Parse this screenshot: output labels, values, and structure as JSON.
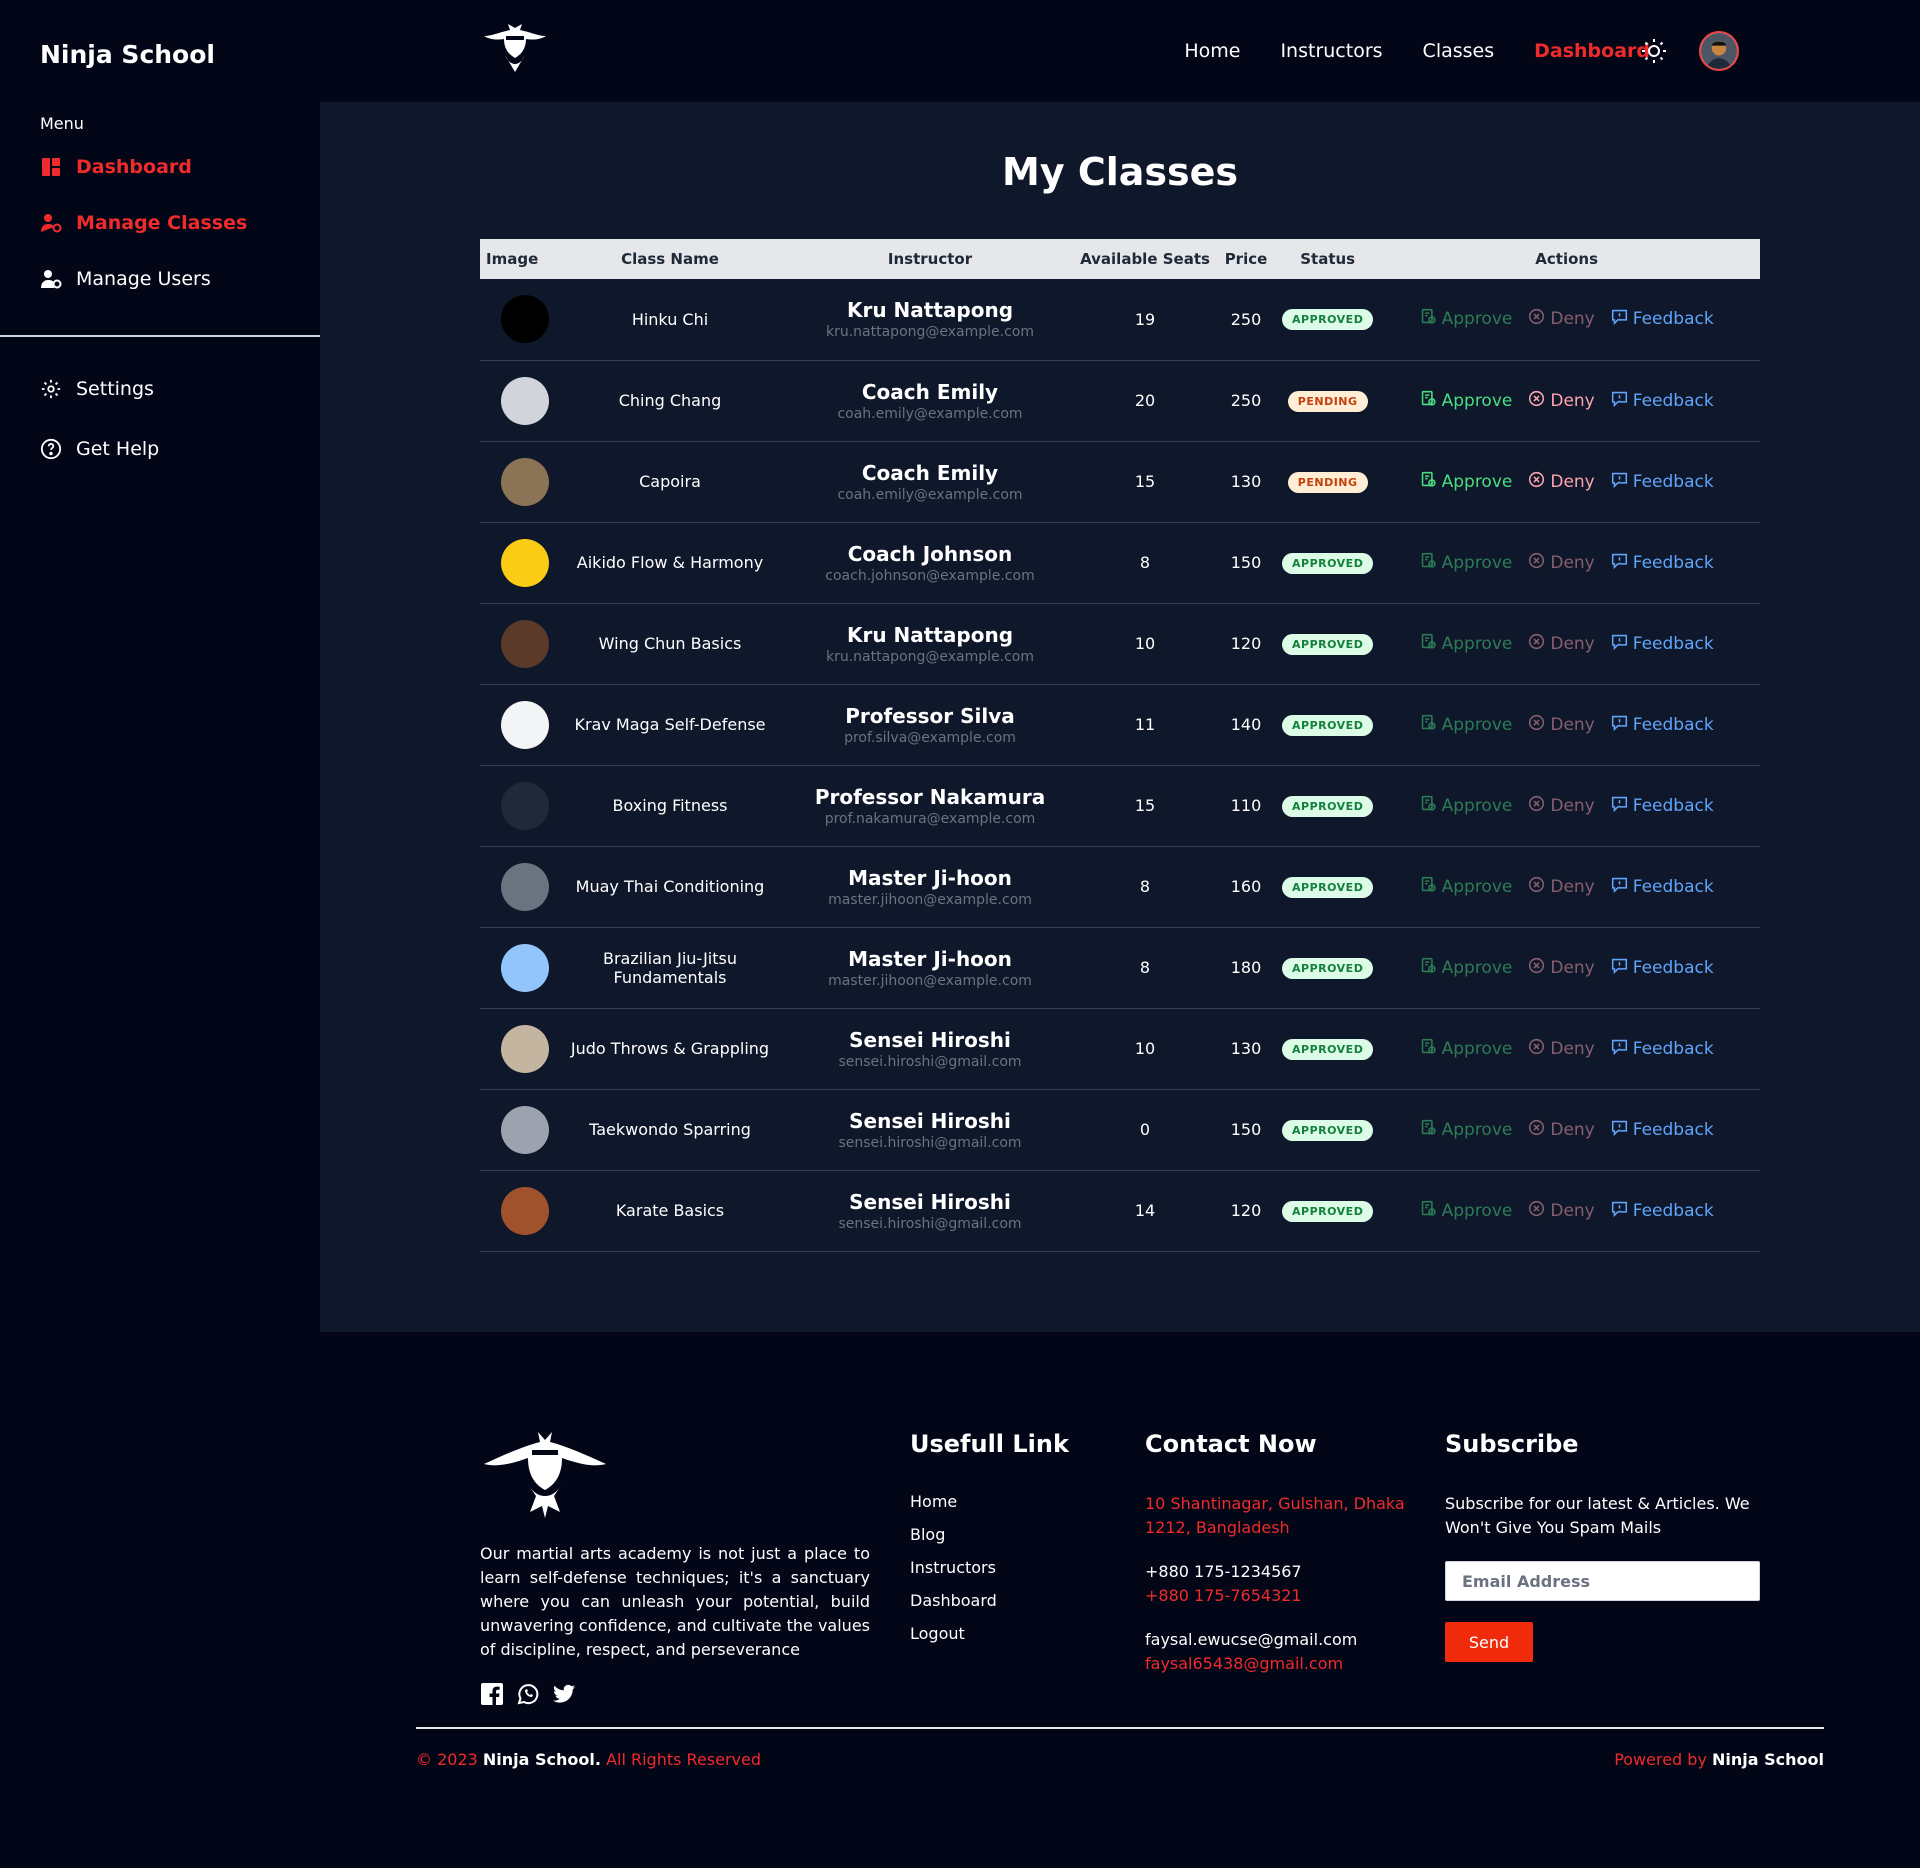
{
  "sidebar": {
    "brand": "Ninja School",
    "menu_label": "Menu",
    "items": [
      {
        "label": "Dashboard"
      },
      {
        "label": "Manage Classes"
      },
      {
        "label": "Manage Users"
      }
    ],
    "bottom_items": [
      {
        "label": "Settings"
      },
      {
        "label": "Get Help"
      }
    ]
  },
  "topnav": {
    "links": [
      "Home",
      "Instructors",
      "Classes",
      "Dashboard"
    ],
    "active": "Dashboard"
  },
  "main": {
    "title": "My Classes",
    "columns": [
      "Image",
      "Class Name",
      "Instructor",
      "Available Seats",
      "Price",
      "Status",
      "Actions"
    ],
    "action_labels": {
      "approve": "Approve",
      "deny": "Deny",
      "feedback": "Feedback"
    },
    "rows": [
      {
        "class_name": "Hinku Chi",
        "instructor": "Kru Nattapong",
        "email": "kru.nattapong@example.com",
        "seats": "19",
        "price": "250",
        "status": "APPROVED",
        "thumb_color": "#000000"
      },
      {
        "class_name": "Ching Chang",
        "instructor": "Coach Emily",
        "email": "coah.emily@example.com",
        "seats": "20",
        "price": "250",
        "status": "PENDING",
        "thumb_color": "#d1d5db"
      },
      {
        "class_name": "Capoira",
        "instructor": "Coach Emily",
        "email": "coah.emily@example.com",
        "seats": "15",
        "price": "130",
        "status": "PENDING",
        "thumb_color": "#8b7355"
      },
      {
        "class_name": "Aikido Flow & Harmony",
        "instructor": "Coach Johnson",
        "email": "coach.johnson@example.com",
        "seats": "8",
        "price": "150",
        "status": "APPROVED",
        "thumb_color": "#facc15"
      },
      {
        "class_name": "Wing Chun Basics",
        "instructor": "Kru Nattapong",
        "email": "kru.nattapong@example.com",
        "seats": "10",
        "price": "120",
        "status": "APPROVED",
        "thumb_color": "#5b3a29"
      },
      {
        "class_name": "Krav Maga Self-Defense",
        "instructor": "Professor Silva",
        "email": "prof.silva@example.com",
        "seats": "11",
        "price": "140",
        "status": "APPROVED",
        "thumb_color": "#f3f4f6"
      },
      {
        "class_name": "Boxing Fitness",
        "instructor": "Professor Nakamura",
        "email": "prof.nakamura@example.com",
        "seats": "15",
        "price": "110",
        "status": "APPROVED",
        "thumb_color": "#1f2937"
      },
      {
        "class_name": "Muay Thai Conditioning",
        "instructor": "Master Ji-hoon",
        "email": "master.jihoon@example.com",
        "seats": "8",
        "price": "160",
        "status": "APPROVED",
        "thumb_color": "#6b7280"
      },
      {
        "class_name": "Brazilian Jiu-Jitsu Fundamentals",
        "instructor": "Master Ji-hoon",
        "email": "master.jihoon@example.com",
        "seats": "8",
        "price": "180",
        "status": "APPROVED",
        "thumb_color": "#93c5fd"
      },
      {
        "class_name": "Judo Throws & Grappling",
        "instructor": "Sensei Hiroshi",
        "email": "sensei.hiroshi@gmail.com",
        "seats": "10",
        "price": "130",
        "status": "APPROVED",
        "thumb_color": "#c4b5a0"
      },
      {
        "class_name": "Taekwondo Sparring",
        "instructor": "Sensei Hiroshi",
        "email": "sensei.hiroshi@gmail.com",
        "seats": "0",
        "price": "150",
        "status": "APPROVED",
        "thumb_color": "#9ca3af"
      },
      {
        "class_name": "Karate Basics",
        "instructor": "Sensei Hiroshi",
        "email": "sensei.hiroshi@gmail.com",
        "seats": "14",
        "price": "120",
        "status": "APPROVED",
        "thumb_color": "#a0522d"
      }
    ]
  },
  "footer": {
    "about": "Our martial arts academy is not just a place to learn self-defense techniques; it's a sanctuary where you can unleash your potential, build unwavering confidence, and cultivate the values of discipline, respect, and perseverance",
    "links_title": "Usefull Link",
    "links": [
      "Home",
      "Blog",
      "Instructors",
      "Dashboard",
      "Logout"
    ],
    "contact_title": "Contact Now",
    "address": "10 Shantinagar, Gulshan, Dhaka 1212, Bangladesh",
    "phone1": "+880 175-1234567",
    "phone2": "+880 175-7654321",
    "email1": "faysal.ewucse@gmail.com",
    "email2": "faysal65438@gmail.com",
    "subscribe_title": "Subscribe",
    "subscribe_text": "Subscribe for our latest & Articles. We Won't Give You Spam Mails",
    "email_placeholder": "Email Address",
    "send_label": "Send",
    "copyright_prefix": "© 2023",
    "copyright_brand": "Ninja School.",
    "copyright_suffix": "All Rights Reserved",
    "powered_prefix": "Powered by",
    "powered_brand": "Ninja School"
  },
  "colors": {
    "accent": "#ef2b2b",
    "background": "#020617",
    "panel": "#0f172a"
  }
}
